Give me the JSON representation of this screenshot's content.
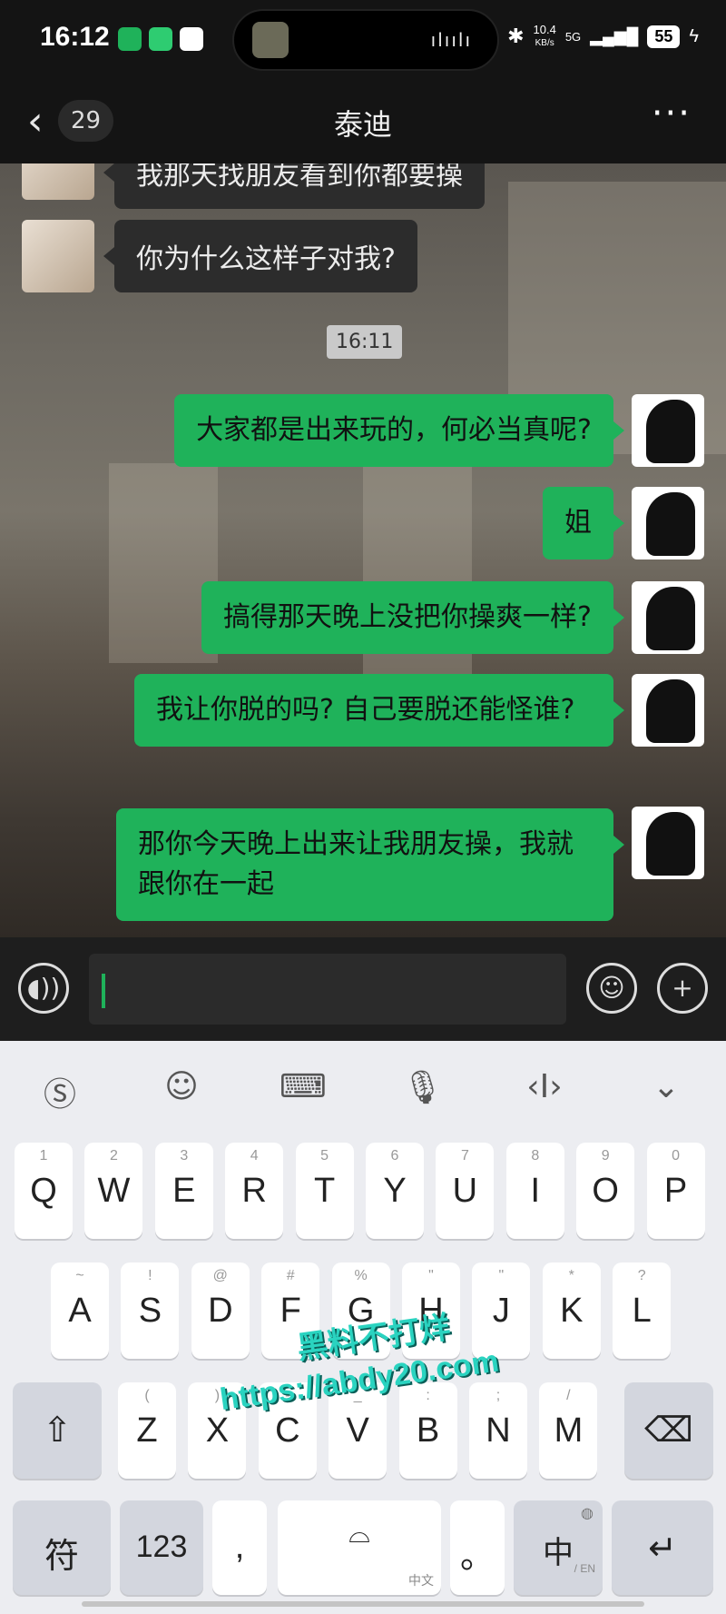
{
  "status": {
    "time": "16:12",
    "net_speed": "10.4",
    "net_unit": "KB/s",
    "network": "5G",
    "battery": "55"
  },
  "nav": {
    "back_count": "29",
    "title": "泰迪",
    "more": "···"
  },
  "chat": {
    "messages": [
      {
        "side": "left",
        "text": "我那天找朋友看到你都要操"
      },
      {
        "side": "left",
        "text": "你为什么这样子对我?"
      },
      {
        "side": "right",
        "text": "大家都是出来玩的，何必当真呢?"
      },
      {
        "side": "right",
        "text": "姐"
      },
      {
        "side": "right",
        "text": "搞得那天晚上没把你操爽一样?"
      },
      {
        "side": "right",
        "text": "我让你脱的吗? 自己要脱还能怪谁?"
      },
      {
        "side": "right",
        "text": "那你今天晚上出来让我朋友操，我就跟你在一起"
      }
    ],
    "timestamp": "16:11"
  },
  "keyboard": {
    "row1": [
      {
        "hint": "1",
        "key": "Q"
      },
      {
        "hint": "2",
        "key": "W"
      },
      {
        "hint": "3",
        "key": "E"
      },
      {
        "hint": "4",
        "key": "R"
      },
      {
        "hint": "5",
        "key": "T"
      },
      {
        "hint": "6",
        "key": "Y"
      },
      {
        "hint": "7",
        "key": "U"
      },
      {
        "hint": "8",
        "key": "I"
      },
      {
        "hint": "9",
        "key": "O"
      },
      {
        "hint": "0",
        "key": "P"
      }
    ],
    "row2": [
      {
        "hint": "~",
        "key": "A"
      },
      {
        "hint": "!",
        "key": "S"
      },
      {
        "hint": "@",
        "key": "D"
      },
      {
        "hint": "#",
        "key": "F"
      },
      {
        "hint": "%",
        "key": "G"
      },
      {
        "hint": "\"",
        "key": "H"
      },
      {
        "hint": "\"",
        "key": "J"
      },
      {
        "hint": "*",
        "key": "K"
      },
      {
        "hint": "?",
        "key": "L"
      }
    ],
    "row3": [
      {
        "hint": "(",
        "key": "Z"
      },
      {
        "hint": ")",
        "key": "X"
      },
      {
        "hint": "-",
        "key": "C"
      },
      {
        "hint": "_",
        "key": "V"
      },
      {
        "hint": ":",
        "key": "B"
      },
      {
        "hint": ";",
        "key": "N"
      },
      {
        "hint": "/",
        "key": "M"
      }
    ],
    "symbols_key": "符",
    "numbers_key": "123",
    "comma_key": ",",
    "space_sublabel": "中文",
    "period_key": "。",
    "lang_key": "中",
    "lang_sub": "/ EN"
  },
  "watermark": {
    "line1": "黑料不打烊",
    "line2": "https://abdy20.com"
  }
}
